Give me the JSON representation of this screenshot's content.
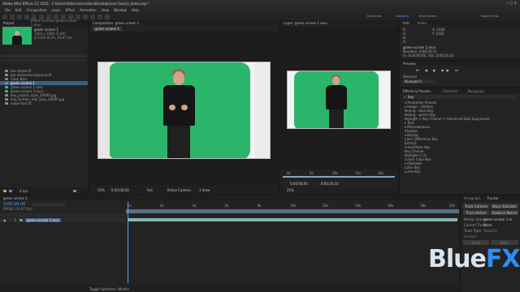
{
  "app": {
    "title": "Adobe After Effects CC 2015 - C:\\Users\\Video Instruction\\Desktop\\Live Class\\3_demo.aep *"
  },
  "menu": [
    "File",
    "Edit",
    "Composition",
    "Layer",
    "Effect",
    "Animation",
    "View",
    "Window",
    "Help"
  ],
  "workspaces": [
    "Essentials",
    "Standard",
    "Small Screen"
  ],
  "search_help": "Search Help",
  "project": {
    "tab": "Project",
    "footage_name": "green screen 1",
    "footage_info": "1920 x 1080 (1.00)",
    "footage_info2": "Δ 0;00;00;00, 29.97 fps",
    "items": [
      "bar-stroke.tif",
      "bar-stroke-background.tif",
      "Color Bars",
      "green screen 1",
      "green screen 1.mov",
      "green-screen 1.mov",
      "hey_justice_style_20000.jpg",
      "hey_turbine_tool_blue_20000.jpg",
      "maps-text.tif"
    ],
    "selected_index": 3,
    "bpc": "8 bpc"
  },
  "effect_controls_tab": "Effect Controls green-screen 1.mov",
  "composition": {
    "tab": "Composition: green screen 1",
    "breadcrumb": "green screen 1",
    "zoom": "25%",
    "time": "0;00;00;00",
    "resolution": "Full",
    "camera": "Active Camera",
    "views": "1 View"
  },
  "layer": {
    "tab": "Layer: green-screen 1.mov",
    "ruler": [
      "0s",
      "5s",
      "10s",
      "15s",
      "20s"
    ],
    "zoom": "25%",
    "time_in": "0;00;00;00",
    "time_out": "0;00;20;10"
  },
  "info": {
    "tab": "Info",
    "audio_tab": "Audio",
    "r": "R:",
    "g": "G:",
    "b": "B:",
    "a": "A:",
    "x": "X: 1564",
    "y": "Y: 1032",
    "layer_name": "green-screen 1.mov",
    "duration": "Duration: 0;00;20;11",
    "in_out": "In: 0;00;00;00, Out: 0;00;20;10"
  },
  "preview": {
    "tab": "Preview",
    "shortcut_label": "Shortcut",
    "shortcut_value": "Numpad 0"
  },
  "effects": {
    "tab": "Effects & Presets",
    "tab2": "Character",
    "tab3": "Paragraph",
    "search": "key",
    "rows": [
      "▾ Animation Presets",
      "  ▾ Image - Utilities",
      "      Keying - blue bkg",
      "      Keying - green bkg",
      "      Keylight + Key Cleaner + Advanced Spill Suppressor",
      "  ▾ Text",
      "    ▾ Miscellaneous",
      "        Shadow",
      "▾ Keying",
      "    Color Difference Key",
      "    Extract",
      "    Inner/Outer Key",
      "    Key Cleaner",
      "    Keylight (1.2)",
      "    Linear Color Key",
      "▾ Obsolete",
      "    Color Key",
      "    Luma Key"
    ]
  },
  "timeline": {
    "tab": "green screen 1",
    "time": "0;00;00;00",
    "fps": "00000 (29.97 fps)",
    "search": "",
    "layer_num": "1",
    "layer_name": "green-screen 1.mov",
    "ruler": [
      "0s",
      "2s",
      "4s",
      "6s",
      "8s",
      "10s",
      "12s",
      "14s",
      "16s",
      "18s",
      "20s"
    ],
    "toggle": "Toggle Switches / Modes"
  },
  "tracker": {
    "tab1": "Paragraph",
    "tab2": "Tracker",
    "track_camera": "Track Camera",
    "warp_stabilizer": "Warp Stabilizer",
    "track_motion": "Track Motion",
    "stabilize_motion": "Stabilize Motion",
    "motion_source_label": "Motion Source:",
    "motion_source": "green-screen 1.m",
    "current_track_label": "Current Track:",
    "current_track": "None",
    "track_type_label": "Track Type:",
    "track_type": "Stabilize",
    "analyze": "Analyze:",
    "reset": "Reset",
    "apply": "Apply"
  },
  "watermark": {
    "brand_part1": "Blue",
    "brand_part2": "FX"
  },
  "colors": {
    "accent": "#2a8ff5",
    "greenscreen": "#2bb56b",
    "selection": "#3e5f86"
  }
}
